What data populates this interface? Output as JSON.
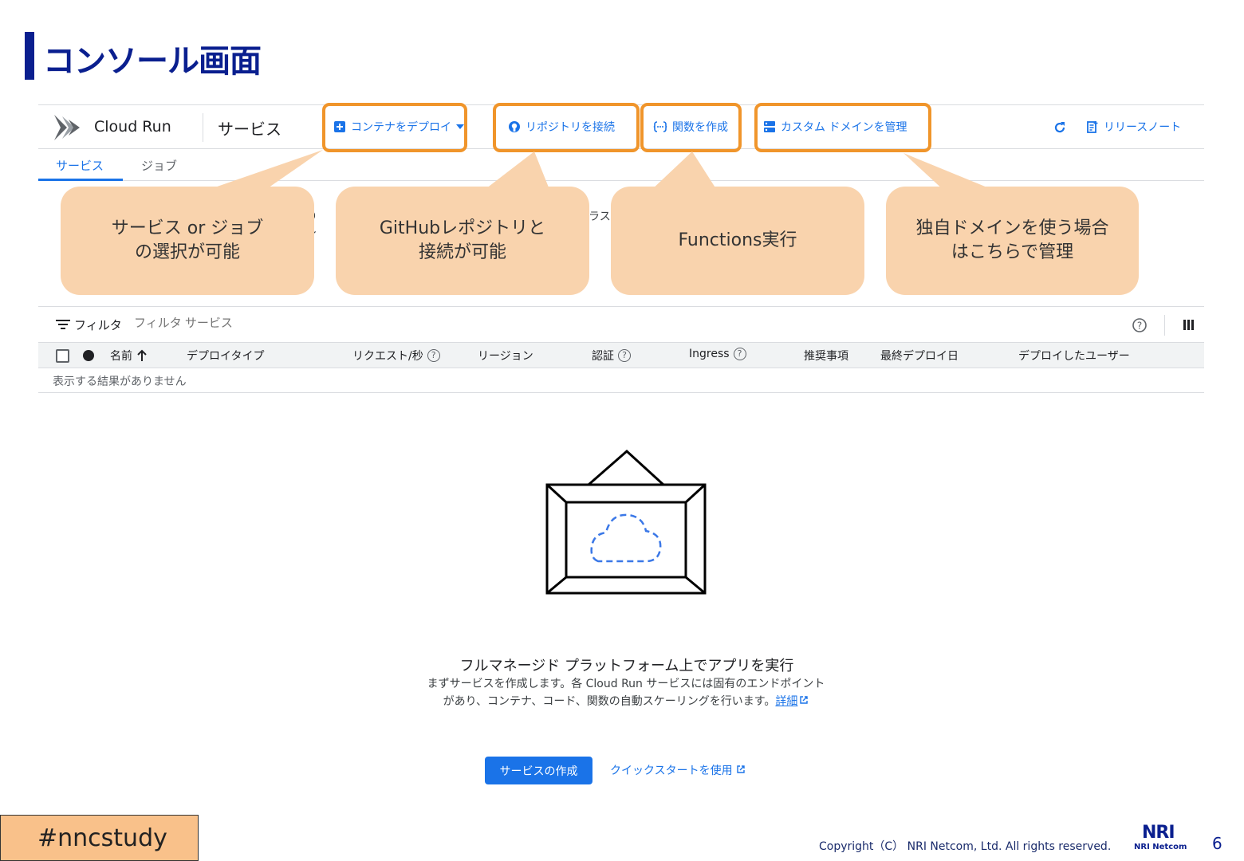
{
  "slide": {
    "title": "コンソール画面",
    "hashtag": "#nncstudy",
    "copyright": "Copyright（C） NRI Netcom, Ltd. All rights reserved.",
    "logo_mark": "NRI",
    "logo_text": "NRI Netcom",
    "page_number": "6"
  },
  "colors": {
    "accent": "#1a73e8",
    "title": "#0a1f8f",
    "callout": "#f9d3ad",
    "highlight": "#f0952b"
  },
  "console": {
    "app_name": "Cloud Run",
    "page_name": "サービス",
    "toolbar": {
      "deploy_container": "コンテナをデプロイ",
      "connect_repo": "リポジトリを接続",
      "create_function": "関数を作成",
      "manage_domains": "カスタム ドメインを管理",
      "release_notes": "リリースノート"
    },
    "tabs": [
      "サービス",
      "ジョブ"
    ],
    "partial_text": [
      "信り",
      "ロイ",
      "ラス"
    ],
    "filter": {
      "label": "フィルタ",
      "placeholder": "フィルタ サービス"
    },
    "table": {
      "columns": [
        "名前",
        "デプロイタイプ",
        "リクエスト/秒",
        "リージョン",
        "認証",
        "Ingress",
        "推奨事項",
        "最終デプロイ日",
        "デプロイしたユーザー"
      ],
      "empty_text": "表示する結果がありません"
    },
    "empty_state": {
      "title": "フルマネージド プラットフォーム上でアプリを実行",
      "description": "まずサービスを作成します。各 Cloud Run サービスには固有のエンドポイントがあり、コンテナ、コード、関数の自動スケーリングを行います。",
      "learn_more": "詳細",
      "create_button": "サービスの作成",
      "quickstart": "クイックスタートを使用"
    }
  },
  "callouts": {
    "tabs": "サービス or ジョブ\nの選択が可能",
    "repo": "GitHubレポジトリと\n接続が可能",
    "functions": "Functions実行",
    "domain": "独自ドメインを使う場合\nはこちらで管理"
  }
}
